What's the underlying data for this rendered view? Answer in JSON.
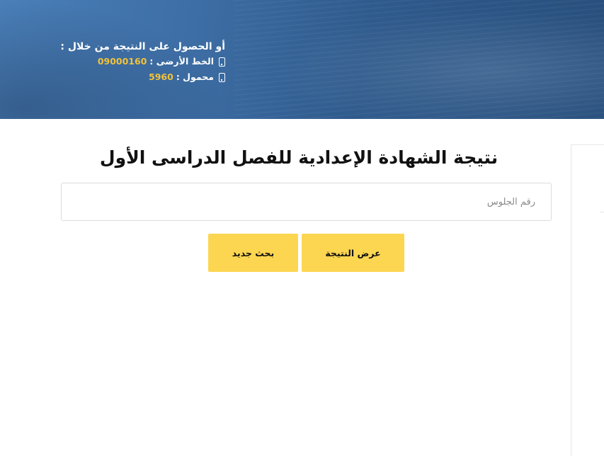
{
  "contact": {
    "heading": "أو الحصول على النتيجة من خلال :",
    "landline_label": "الخط الأرضى :",
    "landline_number": "09000160",
    "mobile_label": "محمول :",
    "mobile_number": "5960",
    "icon": "mobile-phone-icon",
    "accent_color": "#f2c23a"
  },
  "main": {
    "title": "نتيجة الشهادة الإعدادية للفصل الدراسى الأول",
    "seat_input": {
      "placeholder": "رقم الجلوس",
      "value": ""
    },
    "buttons": {
      "show_result": "عرض النتيجة",
      "new_search": "بحث جديد"
    },
    "button_color": "#fdd651"
  }
}
